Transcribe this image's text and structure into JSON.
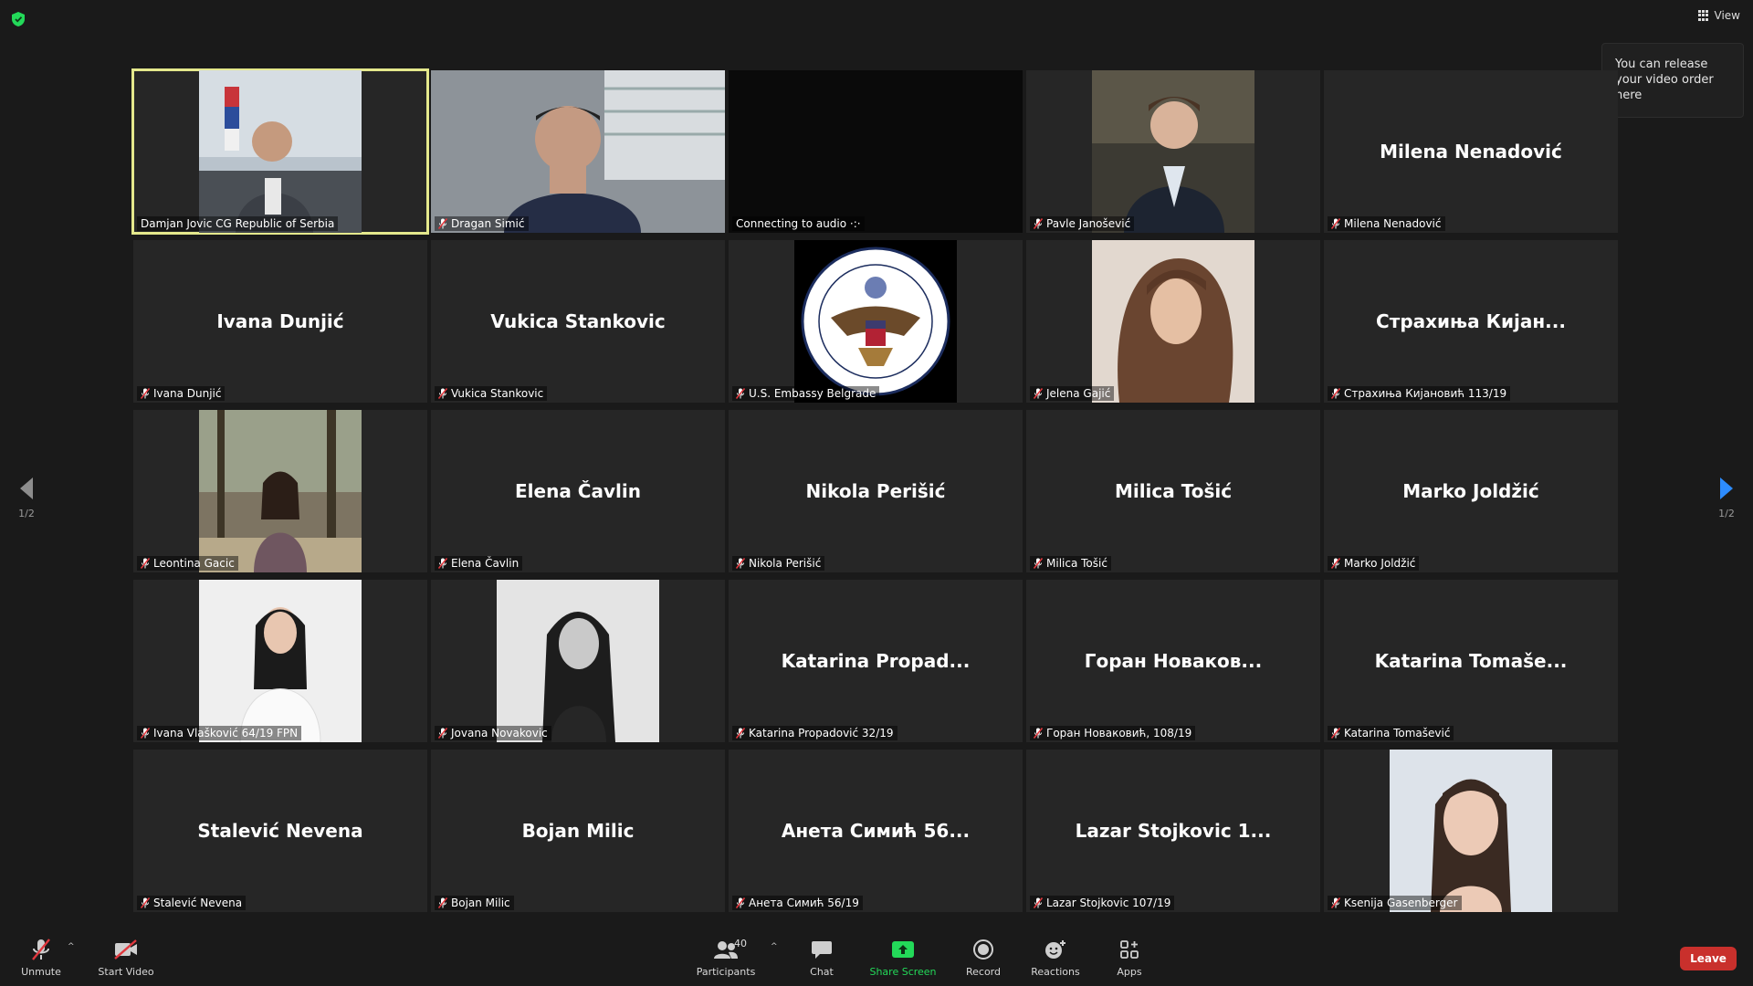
{
  "top": {
    "view_label": "View",
    "tooltip": "You can release your video order here"
  },
  "tiles": [
    {
      "big": "",
      "label": "Damjan Jovic CG Republic of Serbia",
      "muted": false,
      "active": true,
      "photo": "man-with-flag"
    },
    {
      "big": "",
      "label": "Dragan Simić",
      "muted": true,
      "photo": "man-office"
    },
    {
      "big": "",
      "label": "Connecting to audio ·:·",
      "muted": false,
      "photo": "black"
    },
    {
      "big": "",
      "label": "Pavle Janošević",
      "muted": true,
      "photo": "man-suit"
    },
    {
      "big": "Milena Nenadović",
      "label": "Milena Nenadović",
      "muted": true
    },
    {
      "big": "Ivana Dunjić",
      "label": "Ivana Dunjić",
      "muted": true
    },
    {
      "big": "Vukica Stankovic",
      "label": "Vukica Stankovic",
      "muted": true
    },
    {
      "big": "",
      "label": "U.S. Embassy Belgrade",
      "muted": true,
      "photo": "seal"
    },
    {
      "big": "",
      "label": "Jelena Gajić",
      "muted": true,
      "photo": "woman-hair"
    },
    {
      "big": "Страхиња Кијан...",
      "label": "Страхиња Кијановић 113/19",
      "muted": true
    },
    {
      "big": "",
      "label": "Leontina Gacic",
      "muted": true,
      "photo": "woman-forest"
    },
    {
      "big": "Elena Čavlin",
      "label": "Elena Čavlin",
      "muted": true
    },
    {
      "big": "Nikola Perišić",
      "label": "Nikola Perišić",
      "muted": true
    },
    {
      "big": "Milica Tošić",
      "label": "Milica Tošić",
      "muted": true
    },
    {
      "big": "Marko Joldžić",
      "label": "Marko Joldžić",
      "muted": true
    },
    {
      "big": "",
      "label": "Ivana Vlašković 64/19 FPN",
      "muted": true,
      "photo": "woman-white"
    },
    {
      "big": "",
      "label": "Jovana Novakovic",
      "muted": true,
      "photo": "woman-bw"
    },
    {
      "big": "Katarina Propad...",
      "label": "Katarina Propadović 32/19",
      "muted": true
    },
    {
      "big": "Горан Новаков...",
      "label": "Горан Новаковић, 108/19",
      "muted": true
    },
    {
      "big": "Katarina Tomaše...",
      "label": "Katarina Tomašević",
      "muted": true
    },
    {
      "big": "Stalević Nevena",
      "label": "Stalević Nevena",
      "muted": true
    },
    {
      "big": "Bojan Milic",
      "label": "Bojan Milic",
      "muted": true
    },
    {
      "big": "Анета Симић 56...",
      "label": "Анета Симић 56/19",
      "muted": true
    },
    {
      "big": "Lazar Stojkovic 1...",
      "label": "Lazar Stojkovic 107/19",
      "muted": true
    },
    {
      "big": "",
      "label": "Ksenija Gasenberger",
      "muted": true,
      "photo": "woman-portrait"
    }
  ],
  "nav": {
    "prev_page": "1/2",
    "next_page": "1/2"
  },
  "toolbar": {
    "unmute": "Unmute",
    "start_video": "Start Video",
    "participants": "Participants",
    "participants_count": "40",
    "chat": "Chat",
    "share_screen": "Share Screen",
    "record": "Record",
    "reactions": "Reactions",
    "apps": "Apps",
    "leave": "Leave"
  },
  "colors": {
    "accent_green": "#23d959",
    "leave_red": "#c9302c",
    "active_outline": "#e4e88c",
    "nav_blue": "#2d8cff"
  }
}
